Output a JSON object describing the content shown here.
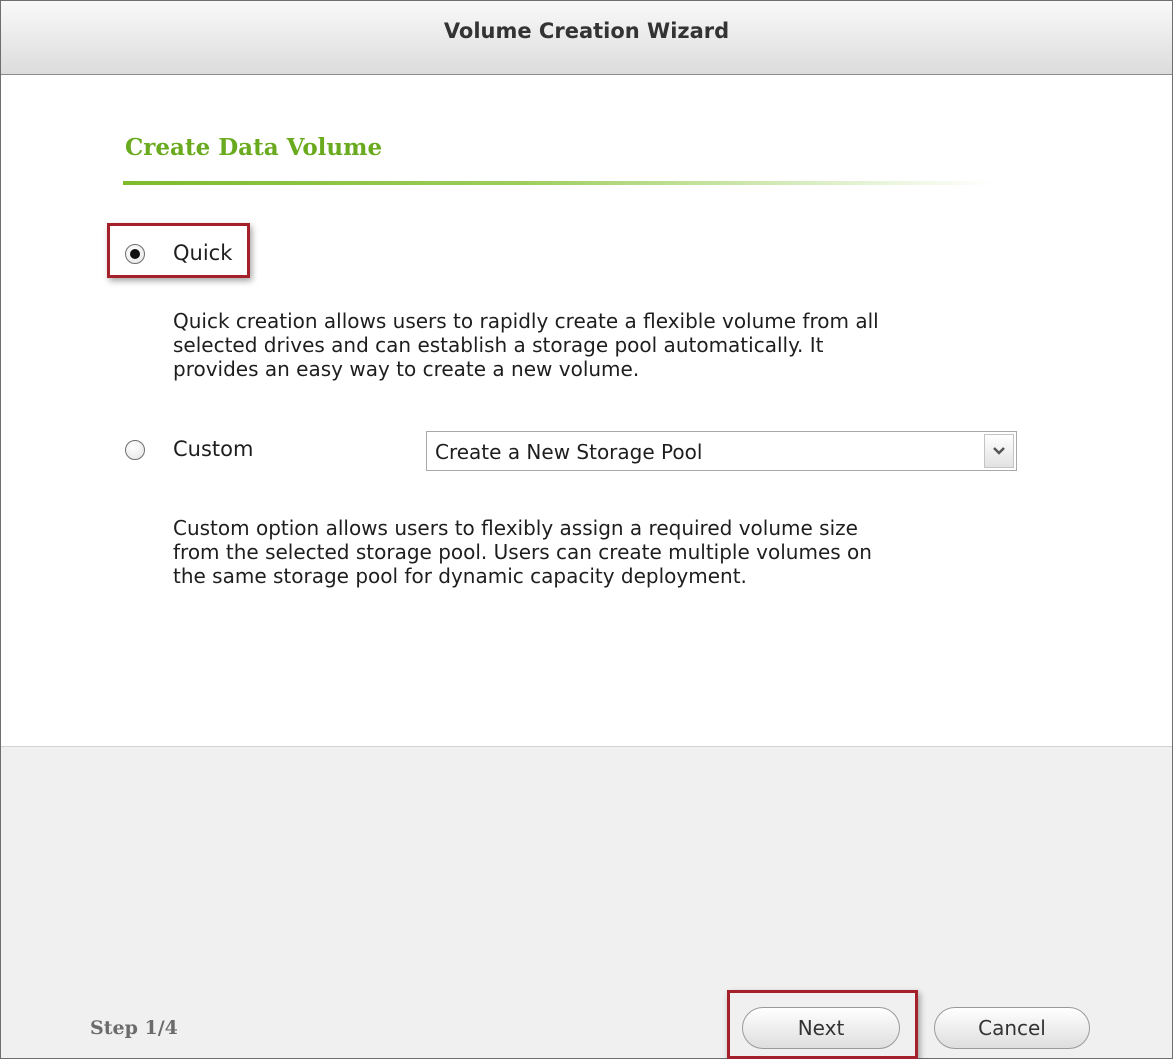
{
  "window": {
    "title": "Volume Creation Wizard"
  },
  "section": {
    "title": "Create Data Volume"
  },
  "options": {
    "quick": {
      "label": "Quick",
      "selected": true,
      "description": "Quick creation allows users to rapidly create a flexible volume from all\nselected drives and can establish a storage pool automatically. It\nprovides an easy way to create a new volume."
    },
    "custom": {
      "label": "Custom",
      "selected": false,
      "pool_select_value": "Create a New Storage Pool",
      "description": "Custom option allows users to flexibly assign a required volume size\nfrom the selected storage pool. Users can create multiple volumes on\nthe same storage pool for dynamic capacity deployment."
    }
  },
  "footer": {
    "step": "Step 1/4",
    "next_label": "Next",
    "cancel_label": "Cancel"
  },
  "colors": {
    "accent_green": "#6aaa1e",
    "highlight_red": "#a4202a"
  }
}
